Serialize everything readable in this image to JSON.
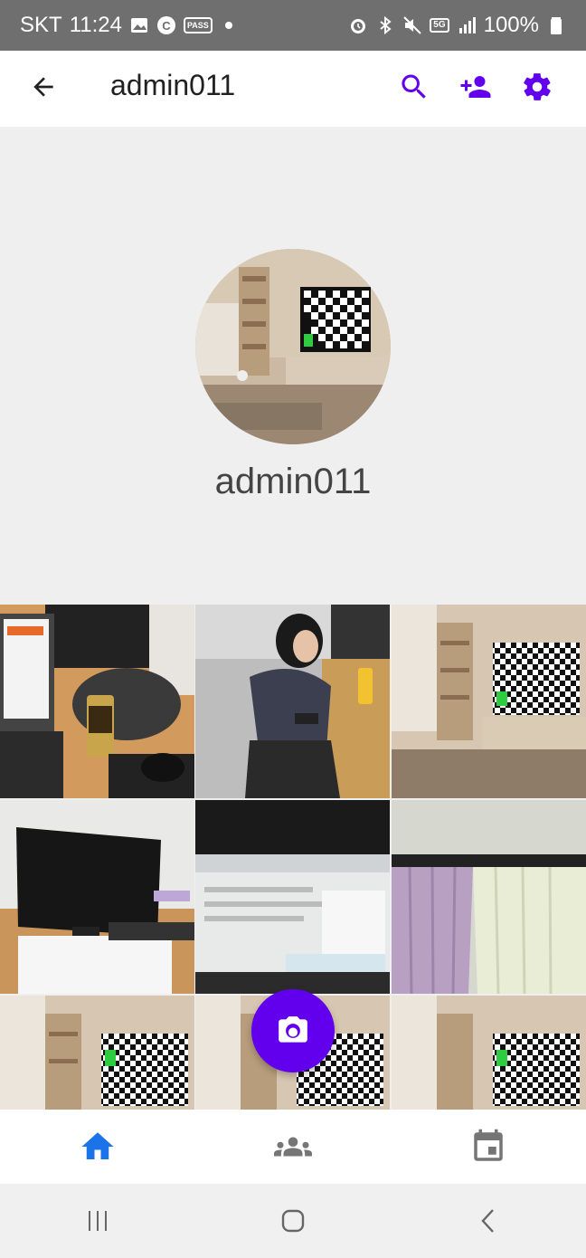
{
  "status_bar": {
    "carrier": "SKT",
    "time": "11:24",
    "battery": "100%",
    "icons_left": [
      "gallery-icon",
      "c-badge-icon",
      "pass-icon",
      "dot-indicator"
    ],
    "pass_label": "PASS",
    "c_label": "C",
    "fiveg_label": "5G",
    "icons_right": [
      "alarm-icon",
      "bluetooth-icon",
      "mute-icon",
      "5g-icon",
      "signal-icon",
      "battery-icon"
    ]
  },
  "app_bar": {
    "title": "admin011",
    "actions": [
      "search-icon",
      "add-person-icon",
      "settings-icon"
    ],
    "accent_color": "#6200ee"
  },
  "profile": {
    "name": "admin011"
  },
  "grid": {
    "tiles": [
      "photo-laptop-desk",
      "photo-person-seated",
      "photo-room-tv",
      "photo-monitor-desk",
      "photo-screen-closeup",
      "photo-curtains",
      "photo-room-tv",
      "photo-room-tv",
      "photo-room-tv"
    ]
  },
  "fab": {
    "icon": "camera-icon",
    "color": "#6200ee"
  },
  "bottom_nav": {
    "items": [
      {
        "name": "home",
        "icon": "home-icon",
        "active": true
      },
      {
        "name": "groups",
        "icon": "group-icon",
        "active": false
      },
      {
        "name": "calendar",
        "icon": "calendar-icon",
        "active": false
      }
    ],
    "active_color": "#1a73e8",
    "inactive_color": "#757575"
  },
  "system_nav": [
    "recents-icon",
    "home-circle-icon",
    "back-chevron-icon"
  ]
}
